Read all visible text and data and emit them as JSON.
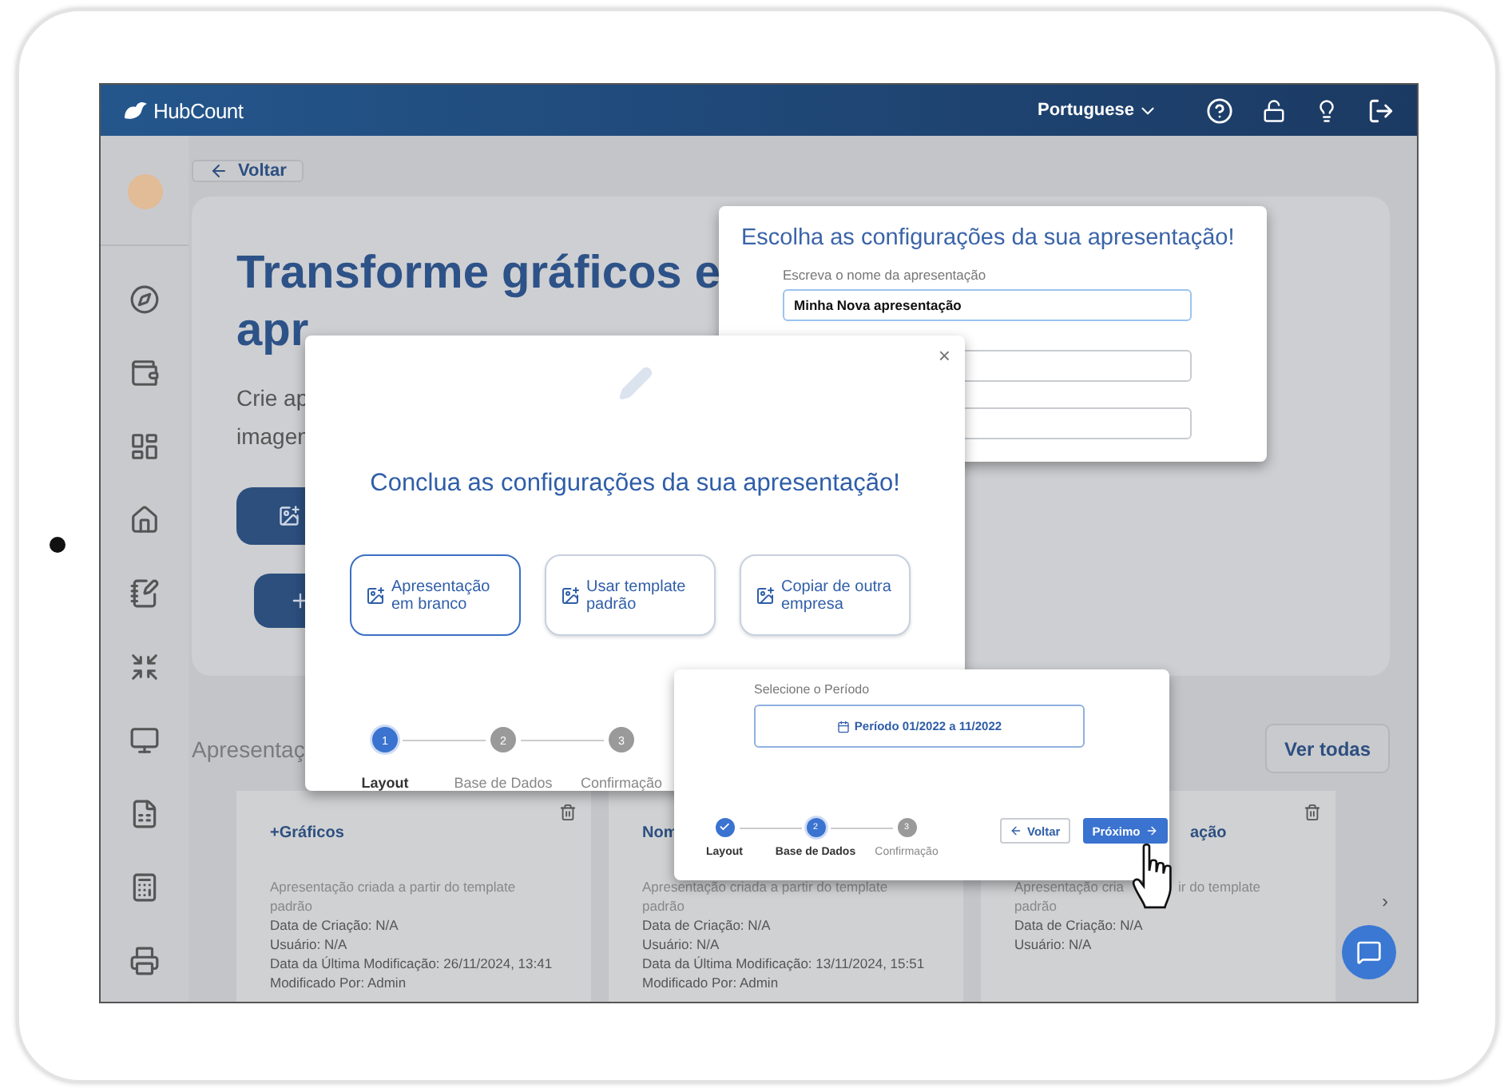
{
  "header": {
    "logo": "HubCount",
    "language": "Portuguese"
  },
  "back_button": "Voltar",
  "hero": {
    "title_lines": [
      "Transforme gráficos e",
      "apr"
    ],
    "subtitle_lines": [
      "Crie ap",
      "imagen"
    ]
  },
  "section_title": "Apresentaç",
  "view_all": "Ver todas",
  "cards": [
    {
      "title": "+Gráficos",
      "lines": [
        [
          "Apresentação criada a partir do template"
        ],
        [
          "padrão"
        ],
        [
          "Data de Criação: N/A"
        ],
        [
          "Usuário: N/A"
        ],
        [
          "Data da Última Modificação: 26/11/2024, 13:41"
        ],
        [
          "Modificado Por: Admin"
        ]
      ]
    },
    {
      "title": "Nom",
      "lines": [
        [
          "Apresentação criada a partir do template"
        ],
        [
          "padrão"
        ],
        [
          "Data de Criação: N/A"
        ],
        [
          "Usuário: N/A"
        ],
        [
          "Data da Última Modificação: 13/11/2024, 15:51"
        ],
        [
          "Modificado Por: Admin"
        ]
      ]
    },
    {
      "title": "ação",
      "lines": [
        [
          "Apresentação cria",
          "ir do template"
        ],
        [
          "padrão"
        ],
        [
          "Data de Criação: N/A"
        ],
        [
          "Usuário: N/A"
        ]
      ]
    }
  ],
  "next_arrow": "›",
  "settings_dialog": {
    "title": "Escolha as configurações da sua apresentação!",
    "name_label": "Escreva o nome da apresentação",
    "name_value": "Minha Nova apresentação"
  },
  "layout_dialog": {
    "close": "×",
    "title": "Conclua as configurações da sua apresentação!",
    "options": [
      {
        "label": "Apresentação em branco",
        "selected": true
      },
      {
        "label": "Usar template padrão",
        "selected": false
      },
      {
        "label": "Copiar de outra empresa",
        "selected": false
      }
    ],
    "steps": [
      {
        "number": "1",
        "label": "Layout",
        "completed": false,
        "active": true
      },
      {
        "number": "2",
        "label": "Base de Dados",
        "completed": false,
        "active": false
      },
      {
        "number": "3",
        "label": "Confirmação",
        "completed": false,
        "active": false
      }
    ]
  },
  "period_dialog": {
    "label": "Selecione o Período",
    "period": "Período 01/2022 a 11/2022",
    "steps": [
      {
        "label": "Layout",
        "completed": true,
        "active": false
      },
      {
        "number": "2",
        "label": "Base de Dados",
        "completed": false,
        "active": true
      },
      {
        "number": "3",
        "label": "Confirmação",
        "completed": false,
        "active": false
      }
    ],
    "back": "Voltar",
    "next": "Próximo"
  }
}
